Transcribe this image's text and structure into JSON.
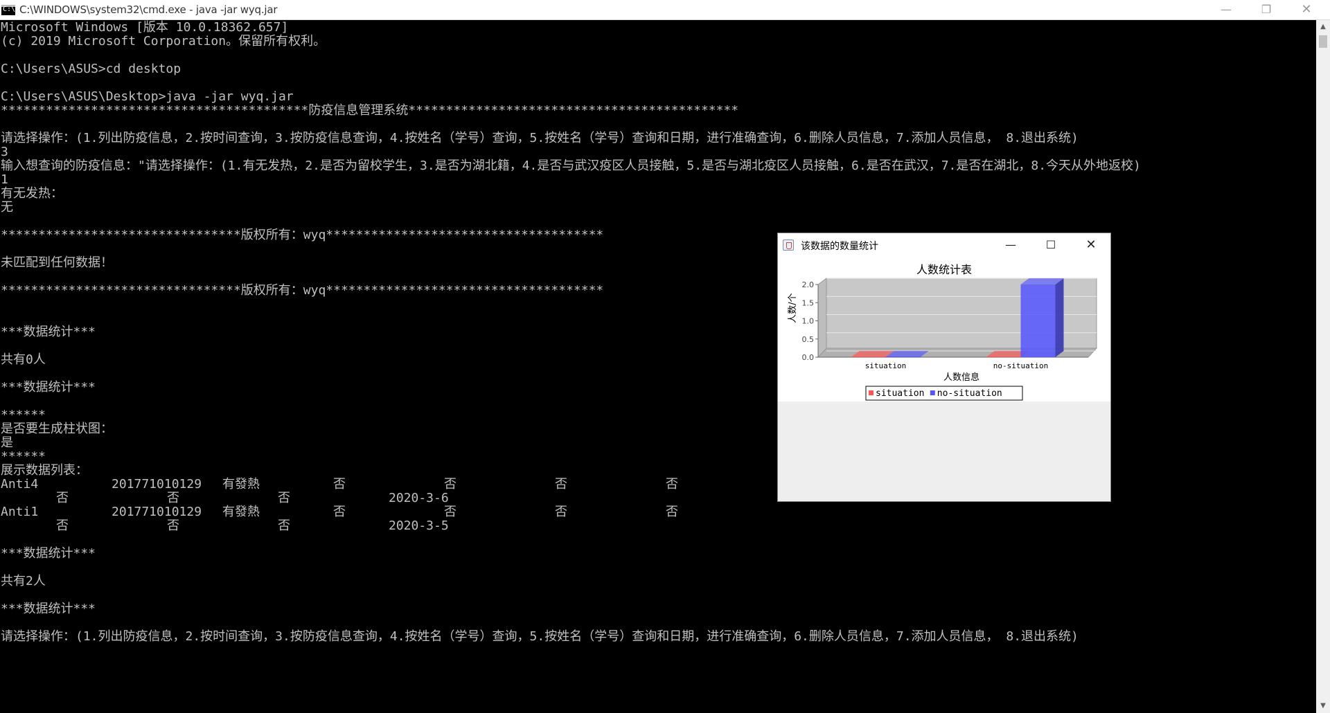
{
  "window": {
    "title": "C:\\WINDOWS\\system32\\cmd.exe - java  -jar wyq.jar",
    "icon": "cmd-icon",
    "icon_text": "C:\\",
    "controls": {
      "minimize": "—",
      "maximize": "❐",
      "close": "✕"
    }
  },
  "console": {
    "lines": [
      {
        "row": 0,
        "segs": [
          {
            "col": 0,
            "text": "Microsoft Windows [版本 10.0.18362.657]"
          }
        ]
      },
      {
        "row": 1,
        "segs": [
          {
            "col": 0,
            "text": "(c) 2019 Microsoft Corporation。保留所有权利。"
          }
        ]
      },
      {
        "row": 3,
        "segs": [
          {
            "col": 0,
            "text": "C:\\Users\\ASUS>cd desktop"
          }
        ]
      },
      {
        "row": 5,
        "segs": [
          {
            "col": 0,
            "text": "C:\\Users\\ASUS\\Desktop>java -jar wyq.jar"
          }
        ]
      },
      {
        "row": 6,
        "segs": [
          {
            "col": 0,
            "text": "*****************************************防疫信息管理系统********************************************"
          }
        ]
      },
      {
        "row": 8,
        "segs": [
          {
            "col": 0,
            "text": "请选择操作：(1.列出防疫信息，2.按时间查询，3.按防疫信息查询，4.按姓名（学号）查询，5.按姓名（学号）查询和日期，进行准确查询，6.删除人员信息，7.添加人员信息， 8.退出系统)"
          }
        ]
      },
      {
        "row": 9,
        "segs": [
          {
            "col": 0,
            "text": "3"
          }
        ]
      },
      {
        "row": 10,
        "segs": [
          {
            "col": 0,
            "text": "输入想查询的防疫信息：\"请选择操作：(1.有无发热，2.是否为留校学生，3.是否为湖北籍，4.是否与武汉疫区人员接触，5.是否与湖北疫区人员接触，6.是否在武汉，7.是否在湖北，8.今天从外地返校)"
          }
        ]
      },
      {
        "row": 11,
        "segs": [
          {
            "col": 0,
            "text": "1"
          }
        ]
      },
      {
        "row": 12,
        "segs": [
          {
            "col": 0,
            "text": "有无发热："
          }
        ]
      },
      {
        "row": 13,
        "segs": [
          {
            "col": 0,
            "text": "无"
          }
        ]
      },
      {
        "row": 15,
        "segs": [
          {
            "col": 0,
            "text": "********************************版权所有：wyq*************************************"
          }
        ]
      },
      {
        "row": 17,
        "segs": [
          {
            "col": 0,
            "text": "未匹配到任何数据！"
          }
        ]
      },
      {
        "row": 19,
        "segs": [
          {
            "col": 0,
            "text": "********************************版权所有：wyq*************************************"
          }
        ]
      },
      {
        "row": 22,
        "segs": [
          {
            "col": 0,
            "text": "***数据统计***"
          }
        ]
      },
      {
        "row": 24,
        "segs": [
          {
            "col": 0,
            "text": "共有0人"
          }
        ]
      },
      {
        "row": 26,
        "segs": [
          {
            "col": 0,
            "text": "***数据统计***"
          }
        ]
      },
      {
        "row": 28,
        "segs": [
          {
            "col": 0,
            "text": "******"
          }
        ]
      },
      {
        "row": 29,
        "segs": [
          {
            "col": 0,
            "text": "是否要生成柱状图："
          }
        ]
      },
      {
        "row": 30,
        "segs": [
          {
            "col": 0,
            "text": "是"
          }
        ]
      },
      {
        "row": 31,
        "segs": [
          {
            "col": 0,
            "text": "******"
          }
        ]
      },
      {
        "row": 32,
        "segs": [
          {
            "col": 0,
            "text": "展示数据列表："
          }
        ]
      },
      {
        "row": 33,
        "segs": [
          {
            "col": 0,
            "text": "Anti4"
          },
          {
            "col": 16,
            "text": "201771010129"
          },
          {
            "col": 32,
            "text": "有發熱"
          },
          {
            "col": 48,
            "text": "否"
          },
          {
            "col": 64,
            "text": "否"
          },
          {
            "col": 80,
            "text": "否"
          },
          {
            "col": 96,
            "text": "否"
          }
        ]
      },
      {
        "row": 34,
        "segs": [
          {
            "col": 8,
            "text": "否"
          },
          {
            "col": 24,
            "text": "否"
          },
          {
            "col": 40,
            "text": "否"
          },
          {
            "col": 56,
            "text": "2020-3-6"
          }
        ]
      },
      {
        "row": 35,
        "segs": [
          {
            "col": 0,
            "text": "Anti1"
          },
          {
            "col": 16,
            "text": "201771010129"
          },
          {
            "col": 32,
            "text": "有發熱"
          },
          {
            "col": 48,
            "text": "否"
          },
          {
            "col": 64,
            "text": "否"
          },
          {
            "col": 80,
            "text": "否"
          },
          {
            "col": 96,
            "text": "否"
          }
        ]
      },
      {
        "row": 36,
        "segs": [
          {
            "col": 8,
            "text": "否"
          },
          {
            "col": 24,
            "text": "否"
          },
          {
            "col": 40,
            "text": "否"
          },
          {
            "col": 56,
            "text": "2020-3-5"
          }
        ]
      },
      {
        "row": 38,
        "segs": [
          {
            "col": 0,
            "text": "***数据统计***"
          }
        ]
      },
      {
        "row": 40,
        "segs": [
          {
            "col": 0,
            "text": "共有2人"
          }
        ]
      },
      {
        "row": 42,
        "segs": [
          {
            "col": 0,
            "text": "***数据统计***"
          }
        ]
      },
      {
        "row": 44,
        "segs": [
          {
            "col": 0,
            "text": "请选择操作：(1.列出防疫信息，2.按时间查询，3.按防疫信息查询，4.按姓名（学号）查询，5.按姓名（学号）查询和日期，进行准确查询，6.删除人员信息，7.添加人员信息， 8.退出系统)"
          }
        ]
      }
    ]
  },
  "scrollbar": {
    "up": "▲",
    "down": "▼"
  },
  "chart_window": {
    "title": "该数据的数量统计",
    "icon": "java-icon",
    "controls": {
      "minimize": "—",
      "maximize": "☐",
      "close": "✕"
    }
  },
  "chart_data": {
    "type": "bar",
    "title": "人数统计表",
    "xlabel": "人数信息",
    "ylabel": "人数/个",
    "categories": [
      "situation",
      "no-situation"
    ],
    "series": [
      {
        "name": "situation",
        "values": [
          0,
          0
        ],
        "color": "#ff5555"
      },
      {
        "name": "no-situation",
        "values": [
          0,
          2
        ],
        "color": "#5555ff"
      }
    ],
    "ylim": [
      0,
      2
    ],
    "yticks": [
      "0.0",
      "0.5",
      "1.0",
      "1.5",
      "2.0"
    ],
    "three_d": true,
    "legend": "bottom"
  }
}
